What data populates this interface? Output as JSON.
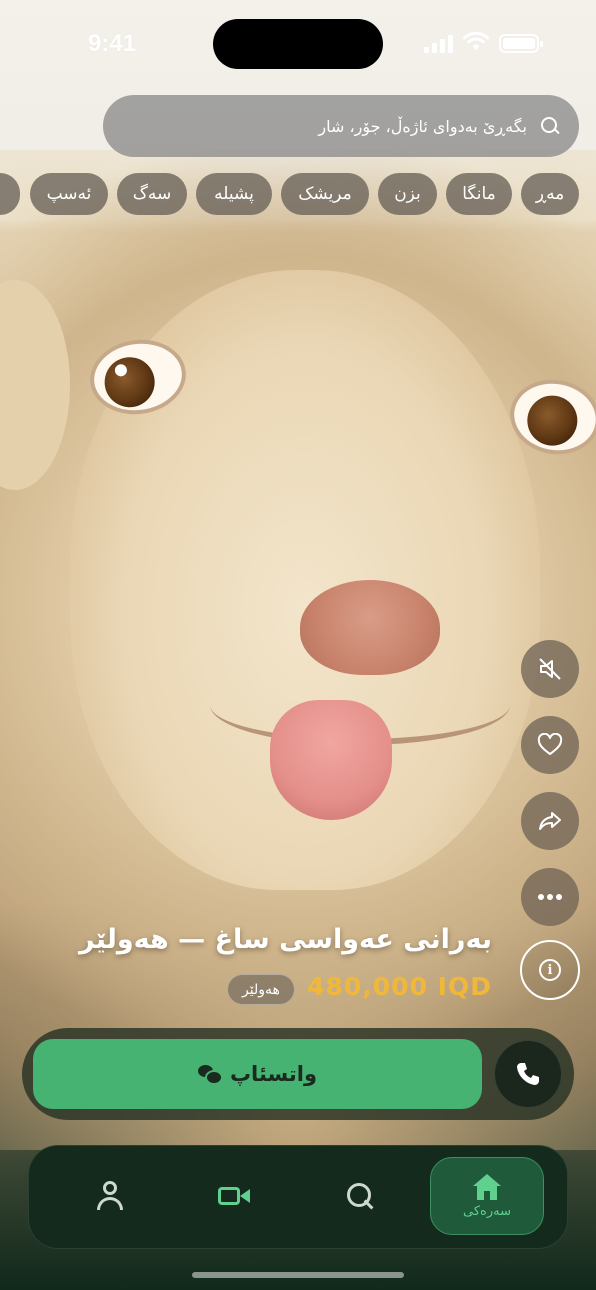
{
  "status": {
    "time": "9:41"
  },
  "search": {
    "placeholder": "بگەڕێ بەدوای ئاژەڵ، جۆر، شار"
  },
  "categories": [
    "مەڕ",
    "مانگا",
    "بزن",
    "مریشک",
    "پشیلە",
    "سەگ",
    "ئەسپ"
  ],
  "listing": {
    "title": "بەرانی عەواسی ساغ — هەولێر",
    "price": "480,000 IQD",
    "city": "هەولێر"
  },
  "actions": {
    "whatsapp_label": "واتسئاپ"
  },
  "tabs": {
    "home_label": "سەرەکی"
  },
  "colors": {
    "accent": "#47b372",
    "price": "#f0b83a",
    "tab_active": "#5fd08e"
  },
  "icons": [
    "search-icon",
    "mute-icon",
    "heart-icon",
    "share-icon",
    "more-icon",
    "info-icon",
    "chat-icon",
    "phone-icon",
    "home-icon",
    "video-icon",
    "profile-icon"
  ]
}
